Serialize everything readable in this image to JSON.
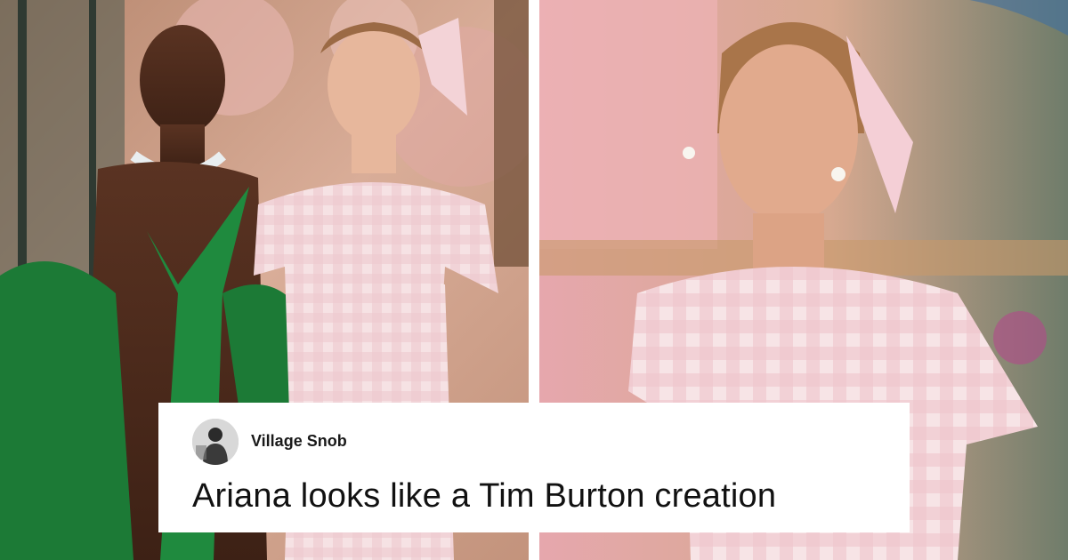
{
  "comment": {
    "username": "Village Snob",
    "text": "Ariana looks like a Tim Burton creation"
  },
  "colors": {
    "green_gown": "#1f8a3e",
    "pink_gingham": "#f2d6dc",
    "backdrop_left": "#c99a86",
    "backdrop_right": "#e7b3b8"
  }
}
